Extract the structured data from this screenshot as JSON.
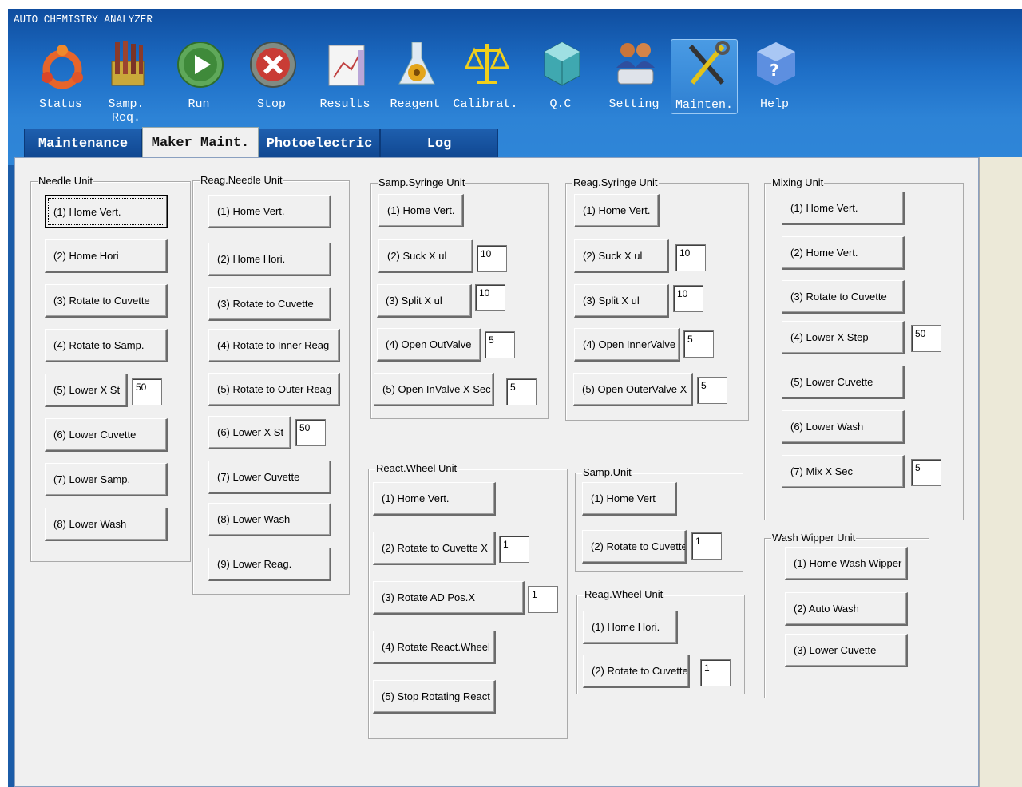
{
  "app_title": "AUTO CHEMISTRY ANALYZER",
  "toolbar": [
    {
      "label": "Status",
      "icon": "status-icon"
    },
    {
      "label": "Samp. Req.",
      "icon": "sample-request-icon"
    },
    {
      "label": "Run",
      "icon": "run-icon"
    },
    {
      "label": "Stop",
      "icon": "stop-icon"
    },
    {
      "label": "Results",
      "icon": "results-icon"
    },
    {
      "label": "Reagent",
      "icon": "reagent-icon"
    },
    {
      "label": "Calibrat.",
      "icon": "calibration-icon"
    },
    {
      "label": "Q.C",
      "icon": "qc-icon"
    },
    {
      "label": "Setting",
      "icon": "setting-icon"
    },
    {
      "label": "Mainten.",
      "icon": "maintenance-icon"
    },
    {
      "label": "Help",
      "icon": "help-icon"
    }
  ],
  "tabs": [
    "Maintenance",
    "Maker Maint.",
    "Photoelectric",
    "Log"
  ],
  "groups": {
    "needle": {
      "title": "Needle Unit",
      "buttons": [
        "(1) Home Vert.",
        "(2) Home Hori",
        "(3) Rotate to Cuvette",
        "(4) Rotate to Samp.",
        "(5) Lower X St",
        "(6) Lower Cuvette",
        "(7) Lower Samp.",
        "(8) Lower Wash"
      ],
      "inputs": [
        "50"
      ]
    },
    "reag_needle": {
      "title": "Reag.Needle Unit",
      "buttons": [
        "(1) Home Vert.",
        "(2) Home Hori.",
        "(3) Rotate to Cuvette",
        "(4) Rotate to Inner Reag",
        "(5) Rotate to Outer Reag",
        "(6) Lower X St",
        "(7) Lower Cuvette",
        "(8) Lower Wash",
        "(9) Lower Reag."
      ],
      "inputs": [
        "50"
      ]
    },
    "samp_syringe": {
      "title": "Samp.Syringe Unit",
      "buttons": [
        "(1) Home Vert.",
        "(2) Suck X ul",
        "(3) Split X ul",
        "(4) Open OutValve",
        "(5) Open InValve X Sec"
      ],
      "inputs": [
        "10",
        "10",
        "5",
        "5"
      ]
    },
    "reag_syringe": {
      "title": "Reag.Syringe Unit",
      "buttons": [
        "(1) Home Vert.",
        "(2) Suck X ul",
        "(3) Split X ul",
        "(4) Open InnerValve",
        "(5) Open OuterValve X"
      ],
      "inputs": [
        "10",
        "10",
        "5",
        "5"
      ]
    },
    "mixing": {
      "title": "Mixing Unit",
      "buttons": [
        "(1) Home Vert.",
        "(2) Home Vert.",
        "(3) Rotate to Cuvette",
        "(4) Lower X Step",
        "(5) Lower Cuvette",
        "(6) Lower Wash",
        "(7) Mix X Sec"
      ],
      "inputs": [
        "50",
        "5"
      ]
    },
    "react_wheel": {
      "title": "React.Wheel Unit",
      "buttons": [
        "(1) Home Vert.",
        "(2) Rotate to Cuvette X",
        "(3) Rotate AD Pos.X",
        "(4) Rotate React.Wheel",
        "(5) Stop Rotating React"
      ],
      "inputs": [
        "1",
        "1"
      ]
    },
    "samp_unit": {
      "title": "Samp.Unit",
      "buttons": [
        "(1) Home Vert",
        "(2) Rotate to Cuvette"
      ],
      "inputs": [
        "1"
      ]
    },
    "reag_wheel": {
      "title": "Reag.Wheel Unit",
      "buttons": [
        "(1) Home Hori.",
        "(2) Rotate to Cuvette"
      ],
      "inputs": [
        "1"
      ]
    },
    "wash_wipper": {
      "title": "Wash Wipper Unit",
      "buttons": [
        "(1) Home Wash Wipper",
        "(2) Auto Wash",
        "(3) Lower Cuvette"
      ],
      "inputs": []
    }
  }
}
